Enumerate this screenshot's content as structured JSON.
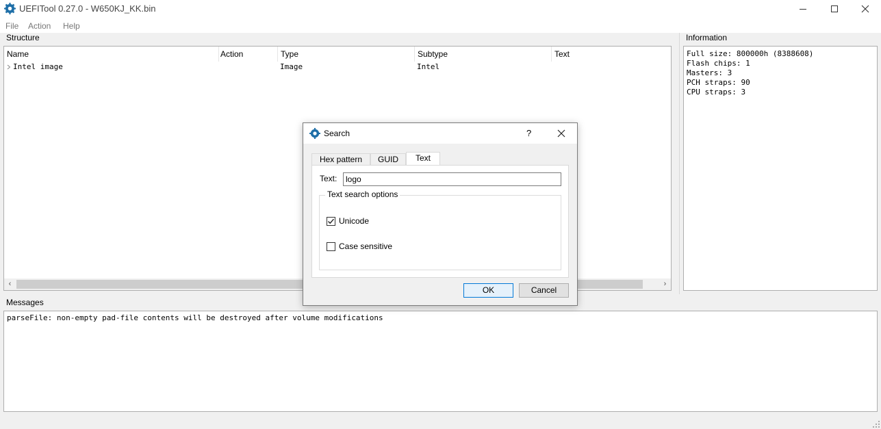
{
  "window": {
    "title": "UEFITool 0.27.0 - W650KJ_KK.bin",
    "controls": [
      "minimize-icon",
      "maximize-icon",
      "close-icon"
    ]
  },
  "menu": {
    "items": [
      "File",
      "Action",
      "Help"
    ]
  },
  "structure": {
    "label": "Structure",
    "columns": [
      "Name",
      "Action",
      "Type",
      "Subtype",
      "Text"
    ],
    "rows": [
      {
        "name": "Intel image",
        "action": "",
        "type": "Image",
        "subtype": "Intel",
        "text": ""
      }
    ]
  },
  "information": {
    "label": "Information",
    "lines": [
      "Full size: 800000h (8388608)",
      "Flash chips: 1",
      "Masters: 3",
      "PCH straps: 90",
      "CPU straps: 3"
    ]
  },
  "messages": {
    "label": "Messages",
    "lines": [
      "parseFile: non-empty pad-file contents will be destroyed after volume modifications"
    ]
  },
  "dialog": {
    "title": "Search",
    "help": "?",
    "tabs": [
      "Hex pattern",
      "GUID",
      "Text"
    ],
    "active_tab": "Text",
    "text_label": "Text:",
    "text_value": "logo",
    "options_group": "Text search options",
    "unicode_label": "Unicode",
    "unicode_checked": true,
    "case_label": "Case sensitive",
    "case_checked": false,
    "ok_label": "OK",
    "cancel_label": "Cancel"
  },
  "colors": {
    "accent": "#0078d7",
    "icon_blue": "#1f6fa8"
  }
}
